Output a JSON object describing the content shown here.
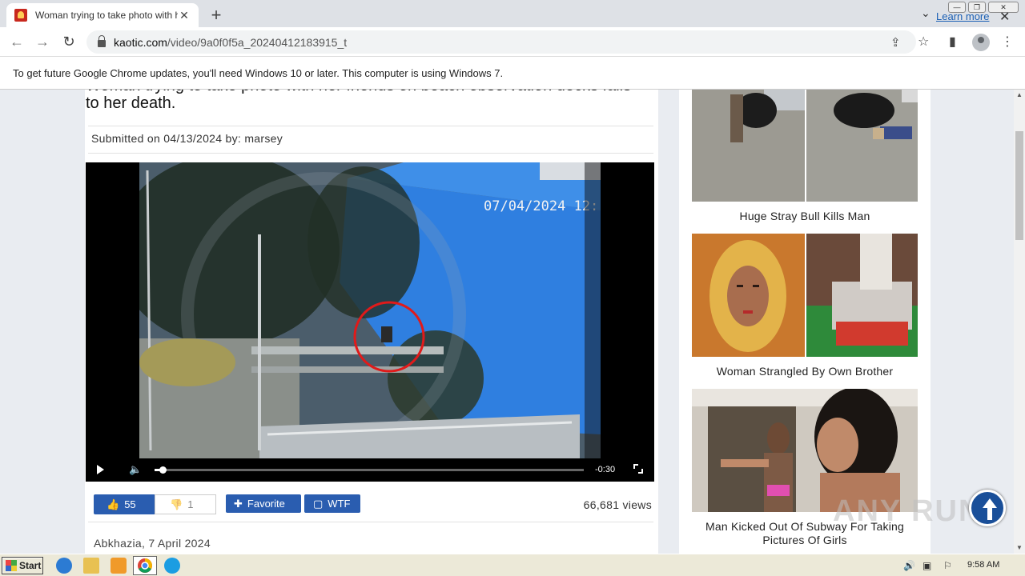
{
  "browser": {
    "tab_title": "Woman trying to take photo with he",
    "new_tab": "+",
    "url_host": "kaotic.com",
    "url_path": "/video/9a0f0f5a_20240412183915_t"
  },
  "infobar": {
    "message": "To get future Google Chrome updates, you'll need Windows 10 or later. This computer is using Windows 7.",
    "learn_more": "Learn more"
  },
  "article": {
    "headline": "Woman trying to take photo with her friends on beach observation decks falls to her death.",
    "submitted_prefix": "Submitted on 04/13/2024 by:",
    "author": "marsey",
    "video": {
      "overlay_timestamp": "07/04/2024 12:",
      "remaining_time": "-0:30",
      "progress_percent": 2
    },
    "likes": "55",
    "dislikes": "1",
    "favorite_label": "Favorite",
    "wtf_label": "WTF",
    "views": "66,681 views",
    "location": "Abkhazia, 7 April 2024"
  },
  "sidebar": {
    "items": [
      {
        "title": "Huge Stray Bull Kills Man"
      },
      {
        "title": "Woman Strangled By Own Brother"
      },
      {
        "title": "Man Kicked Out Of Subway For Taking Pictures Of Girls"
      }
    ]
  },
  "watermark": {
    "text": "ANY RUN"
  },
  "taskbar": {
    "start_label": "Start",
    "clock": "9:58 AM"
  }
}
